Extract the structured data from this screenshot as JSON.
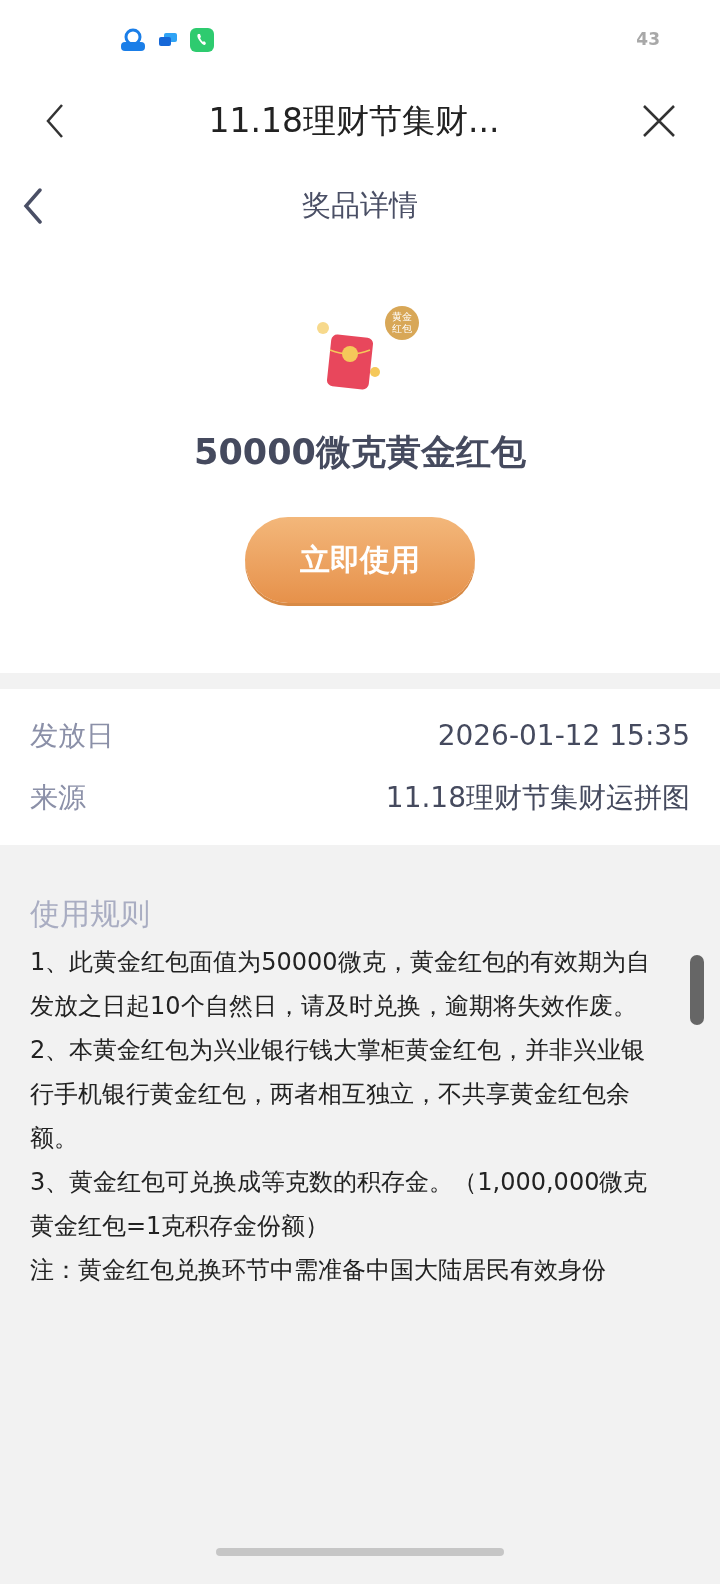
{
  "status_bar": {
    "battery": "43"
  },
  "web_nav": {
    "title": "11.18理财节集财..."
  },
  "page_header": {
    "title": "奖品详情"
  },
  "prize": {
    "badge": "黄金红包",
    "name": "50000微克黄金红包",
    "button": "立即使用"
  },
  "details": [
    {
      "label": "发放日",
      "value": "2026-01-12 15:35"
    },
    {
      "label": "来源",
      "value": "11.18理财节集财运拼图"
    }
  ],
  "rules": {
    "title": "使用规则",
    "items": [
      "1、此黄金红包面值为50000微克，黄金红包的有效期为自发放之日起10个自然日，请及时兑换，逾期将失效作废。",
      "2、本黄金红包为兴业银行钱大掌柜黄金红包，并非兴业银行手机银行黄金红包，两者相互独立，不共享黄金红包余额。",
      "3、黄金红包可兑换成等克数的积存金。（1,000,000微克黄金红包=1克积存金份额）",
      "注：黄金红包兑换环节中需准备中国大陆居民有效身份"
    ]
  }
}
